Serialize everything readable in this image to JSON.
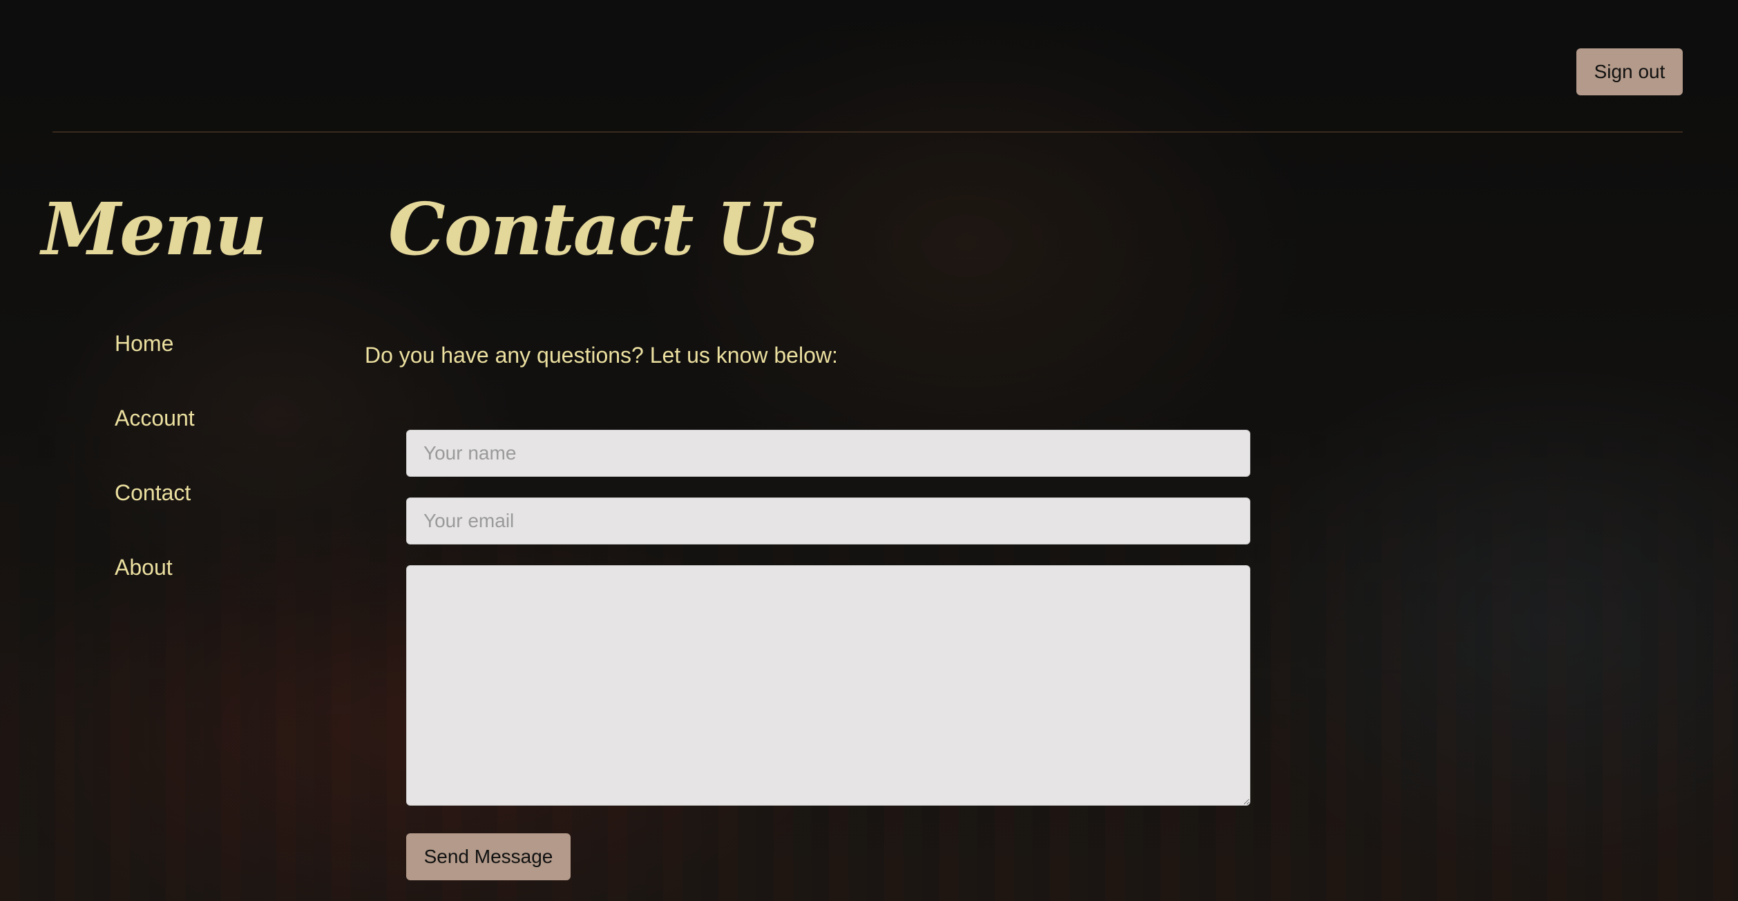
{
  "header": {
    "signout_label": "Sign out"
  },
  "sidebar": {
    "title": "Menu",
    "items": [
      {
        "label": "Home"
      },
      {
        "label": "Account"
      },
      {
        "label": "Contact"
      },
      {
        "label": "About"
      }
    ]
  },
  "main": {
    "title": "Contact Us",
    "intro": "Do you have any questions? Let us know below:",
    "form": {
      "name_placeholder": "Your name",
      "name_value": "",
      "email_placeholder": "Your email",
      "email_value": "",
      "message_value": "",
      "send_label": "Send Message"
    }
  },
  "colors": {
    "accent_text": "#ece0a0",
    "button_bg": "#b39a8a",
    "field_bg": "#e6e4e4"
  }
}
